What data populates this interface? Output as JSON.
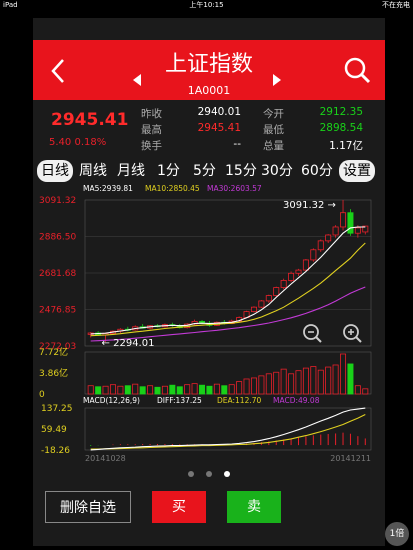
{
  "statusbar": {
    "device": "iPad",
    "time": "上午10:15",
    "battery": "不在充电"
  },
  "header": {
    "title": "上证指数",
    "code": "1A0001"
  },
  "quote": {
    "price": "2945.41",
    "change": "5.40",
    "change_pct": "0.18%",
    "fields": [
      {
        "label": "昨收",
        "value": "2940.01",
        "color": "#ffffff"
      },
      {
        "label": "今开",
        "value": "2912.35",
        "color": "#19d119"
      },
      {
        "label": "最高",
        "value": "2945.41",
        "color": "#ff2b2b"
      },
      {
        "label": "最低",
        "value": "2898.54",
        "color": "#19d119"
      },
      {
        "label": "换手",
        "value": "--",
        "color": "#ffffff"
      },
      {
        "label": "总量",
        "value": "1.17亿",
        "color": "#ffffff"
      }
    ]
  },
  "tabs": [
    "日线",
    "周线",
    "月线",
    "1分",
    "5分",
    "15分",
    "30分",
    "60分"
  ],
  "settings_label": "设置",
  "chart_data": {
    "type": "candlestick",
    "ma_labels": [
      "MA5:2939.81",
      "MA10:2850.45",
      "MA30:2603.57"
    ],
    "ma_colors": [
      "#ffffff",
      "#e0d020",
      "#c23ad6"
    ],
    "price_axis": [
      "3091.32",
      "2886.50",
      "2681.68",
      "2476.85",
      "2272.03"
    ],
    "ylim": [
      2272.03,
      3091.32
    ],
    "high_label": "3091.32",
    "low_label": "2294.01",
    "volume_axis": [
      "7.72亿",
      "3.86亿",
      "0"
    ],
    "macd_label": "MACD(12,26,9)",
    "diff_label": "DIFF:137.25",
    "dea_label": "DEA:112.70",
    "macd_value_label": "MACD:49.08",
    "macd_axis": [
      "137.25",
      "59.49",
      "-18.26"
    ],
    "date_start": "20141028",
    "date_end": "20141211",
    "candles": [
      [
        2337,
        2350,
        2320,
        2345
      ],
      [
        2345,
        2355,
        2330,
        2333
      ],
      [
        2333,
        2348,
        2294,
        2342
      ],
      [
        2342,
        2360,
        2335,
        2355
      ],
      [
        2355,
        2372,
        2345,
        2366
      ],
      [
        2366,
        2380,
        2355,
        2362
      ],
      [
        2362,
        2388,
        2358,
        2380
      ],
      [
        2380,
        2395,
        2370,
        2372
      ],
      [
        2372,
        2390,
        2365,
        2386
      ],
      [
        2386,
        2395,
        2376,
        2380
      ],
      [
        2380,
        2398,
        2375,
        2392
      ],
      [
        2392,
        2403,
        2380,
        2387
      ],
      [
        2387,
        2395,
        2370,
        2375
      ],
      [
        2375,
        2400,
        2370,
        2395
      ],
      [
        2395,
        2420,
        2390,
        2410
      ],
      [
        2410,
        2418,
        2395,
        2400
      ],
      [
        2400,
        2412,
        2380,
        2388
      ],
      [
        2388,
        2410,
        2385,
        2405
      ],
      [
        2405,
        2418,
        2392,
        2398
      ],
      [
        2398,
        2420,
        2395,
        2412
      ],
      [
        2412,
        2438,
        2405,
        2432
      ],
      [
        2432,
        2470,
        2428,
        2465
      ],
      [
        2465,
        2495,
        2460,
        2490
      ],
      [
        2490,
        2530,
        2485,
        2525
      ],
      [
        2525,
        2560,
        2515,
        2555
      ],
      [
        2555,
        2605,
        2550,
        2600
      ],
      [
        2600,
        2650,
        2590,
        2640
      ],
      [
        2640,
        2690,
        2630,
        2680
      ],
      [
        2680,
        2705,
        2665,
        2698
      ],
      [
        2698,
        2760,
        2690,
        2755
      ],
      [
        2755,
        2820,
        2745,
        2812
      ],
      [
        2812,
        2870,
        2800,
        2862
      ],
      [
        2862,
        2900,
        2850,
        2895
      ],
      [
        2895,
        2950,
        2880,
        2940
      ],
      [
        2940,
        3091,
        2920,
        3020
      ],
      [
        3020,
        3040,
        2890,
        2905
      ],
      [
        2905,
        2950,
        2880,
        2935
      ],
      [
        2912,
        2945,
        2898,
        2945
      ]
    ],
    "ma5": [
      2340,
      2342,
      2344,
      2350,
      2356,
      2362,
      2370,
      2375,
      2380,
      2383,
      2386,
      2388,
      2386,
      2388,
      2398,
      2400,
      2398,
      2400,
      2403,
      2405,
      2414,
      2430,
      2450,
      2475,
      2505,
      2545,
      2583,
      2620,
      2655,
      2690,
      2730,
      2770,
      2815,
      2860,
      2905,
      2935,
      2940,
      2940
    ],
    "ma10": [
      2330,
      2332,
      2334,
      2337,
      2341,
      2346,
      2351,
      2355,
      2360,
      2365,
      2370,
      2374,
      2378,
      2381,
      2386,
      2389,
      2392,
      2394,
      2397,
      2400,
      2405,
      2412,
      2422,
      2435,
      2452,
      2470,
      2490,
      2515,
      2540,
      2568,
      2595,
      2625,
      2660,
      2695,
      2730,
      2765,
      2810,
      2850
    ],
    "ma30": [
      2300,
      2302,
      2304,
      2306,
      2309,
      2312,
      2316,
      2320,
      2324,
      2328,
      2332,
      2336,
      2340,
      2344,
      2348,
      2352,
      2356,
      2360,
      2365,
      2370,
      2375,
      2381,
      2387,
      2394,
      2401,
      2410,
      2420,
      2430,
      2442,
      2455,
      2470,
      2486,
      2504,
      2524,
      2546,
      2568,
      2586,
      2603
    ],
    "volumes": [
      1.6,
      1.4,
      1.5,
      1.8,
      1.5,
      1.6,
      1.9,
      1.4,
      1.6,
      1.3,
      1.5,
      1.7,
      1.4,
      1.8,
      2.0,
      1.7,
      1.5,
      1.9,
      1.6,
      1.8,
      2.4,
      2.9,
      3.1,
      3.5,
      3.9,
      4.2,
      4.8,
      3.9,
      4.5,
      5.0,
      5.3,
      4.6,
      5.2,
      5.6,
      7.72,
      5.8,
      1.6,
      1.0
    ],
    "diff": [
      -18,
      -16,
      -14,
      -12,
      -10,
      -9,
      -8,
      -6,
      -5,
      -4,
      -3,
      -2,
      -2,
      -1,
      0,
      1,
      1,
      2,
      3,
      4,
      6,
      9,
      13,
      18,
      24,
      31,
      39,
      48,
      57,
      67,
      78,
      89,
      99,
      110,
      122,
      130,
      133,
      137
    ],
    "dea": [
      -15,
      -15,
      -14,
      -14,
      -13,
      -12,
      -11,
      -10,
      -9,
      -8,
      -7,
      -6,
      -5,
      -4,
      -3,
      -2,
      -2,
      -1,
      0,
      1,
      2,
      3,
      5,
      7,
      10,
      14,
      18,
      23,
      29,
      35,
      42,
      50,
      58,
      67,
      76,
      88,
      100,
      113
    ],
    "macd": [
      -6,
      -2,
      0,
      4,
      6,
      6,
      6,
      8,
      8,
      8,
      8,
      8,
      6,
      6,
      6,
      6,
      6,
      6,
      6,
      6,
      8,
      12,
      16,
      22,
      28,
      34,
      42,
      50,
      56,
      64,
      72,
      78,
      82,
      86,
      92,
      84,
      66,
      49
    ]
  },
  "pager": {
    "count": 3,
    "active": 2
  },
  "buttons": {
    "delete": "删除自选",
    "buy": "买",
    "sell": "卖"
  },
  "zoom_badge": "1倍"
}
